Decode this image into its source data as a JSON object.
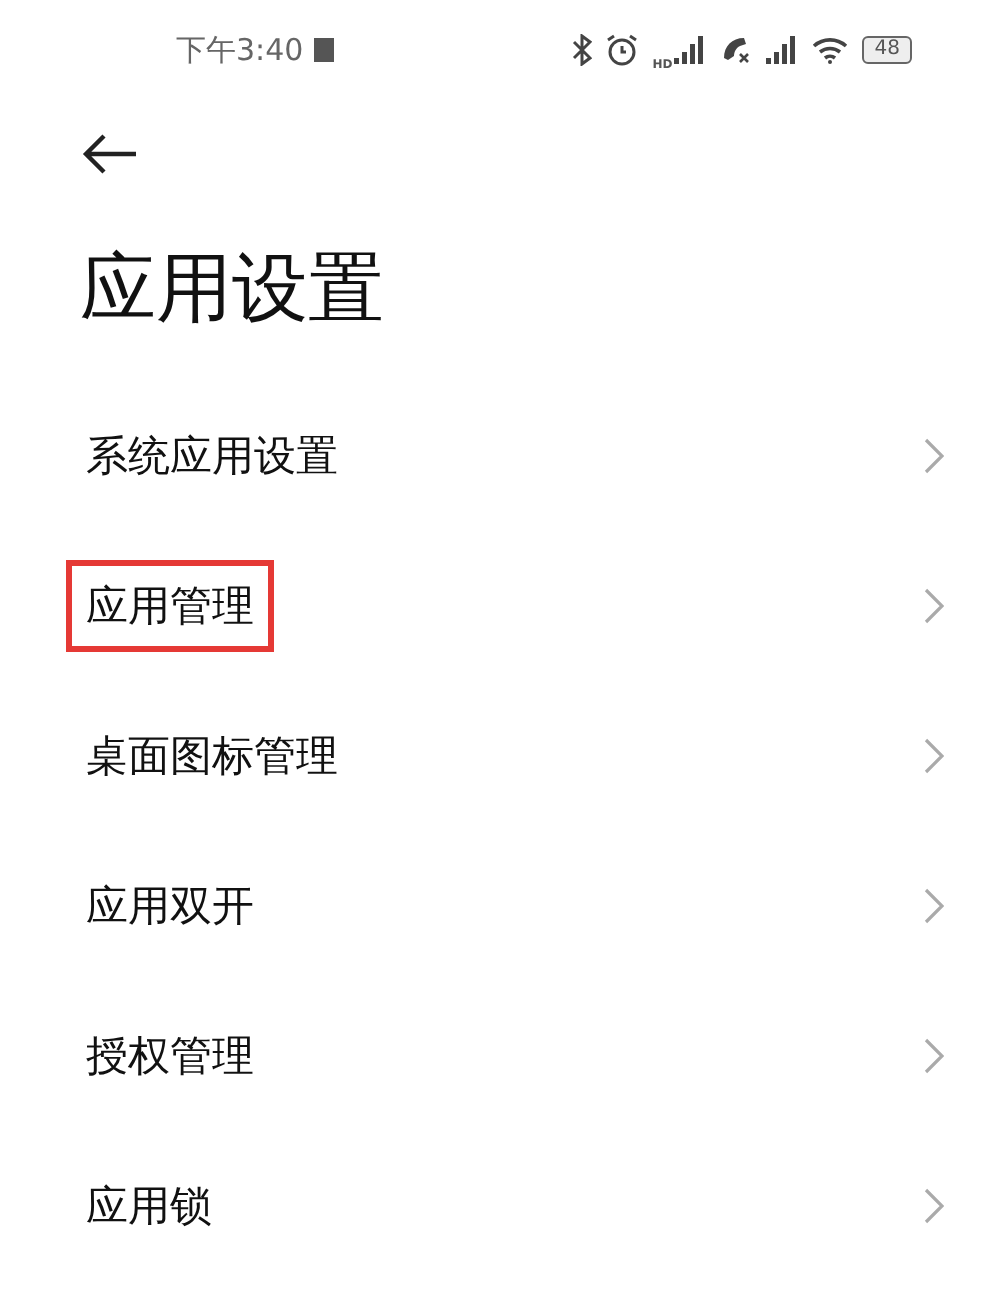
{
  "status_bar": {
    "time": "下午3:40",
    "network_label": "HD",
    "battery": "48"
  },
  "title": "应用设置",
  "items": [
    {
      "label": "系统应用设置",
      "highlighted": false
    },
    {
      "label": "应用管理",
      "highlighted": true
    },
    {
      "label": "桌面图标管理",
      "highlighted": false
    },
    {
      "label": "应用双开",
      "highlighted": false
    },
    {
      "label": "授权管理",
      "highlighted": false
    },
    {
      "label": "应用锁",
      "highlighted": false
    }
  ]
}
